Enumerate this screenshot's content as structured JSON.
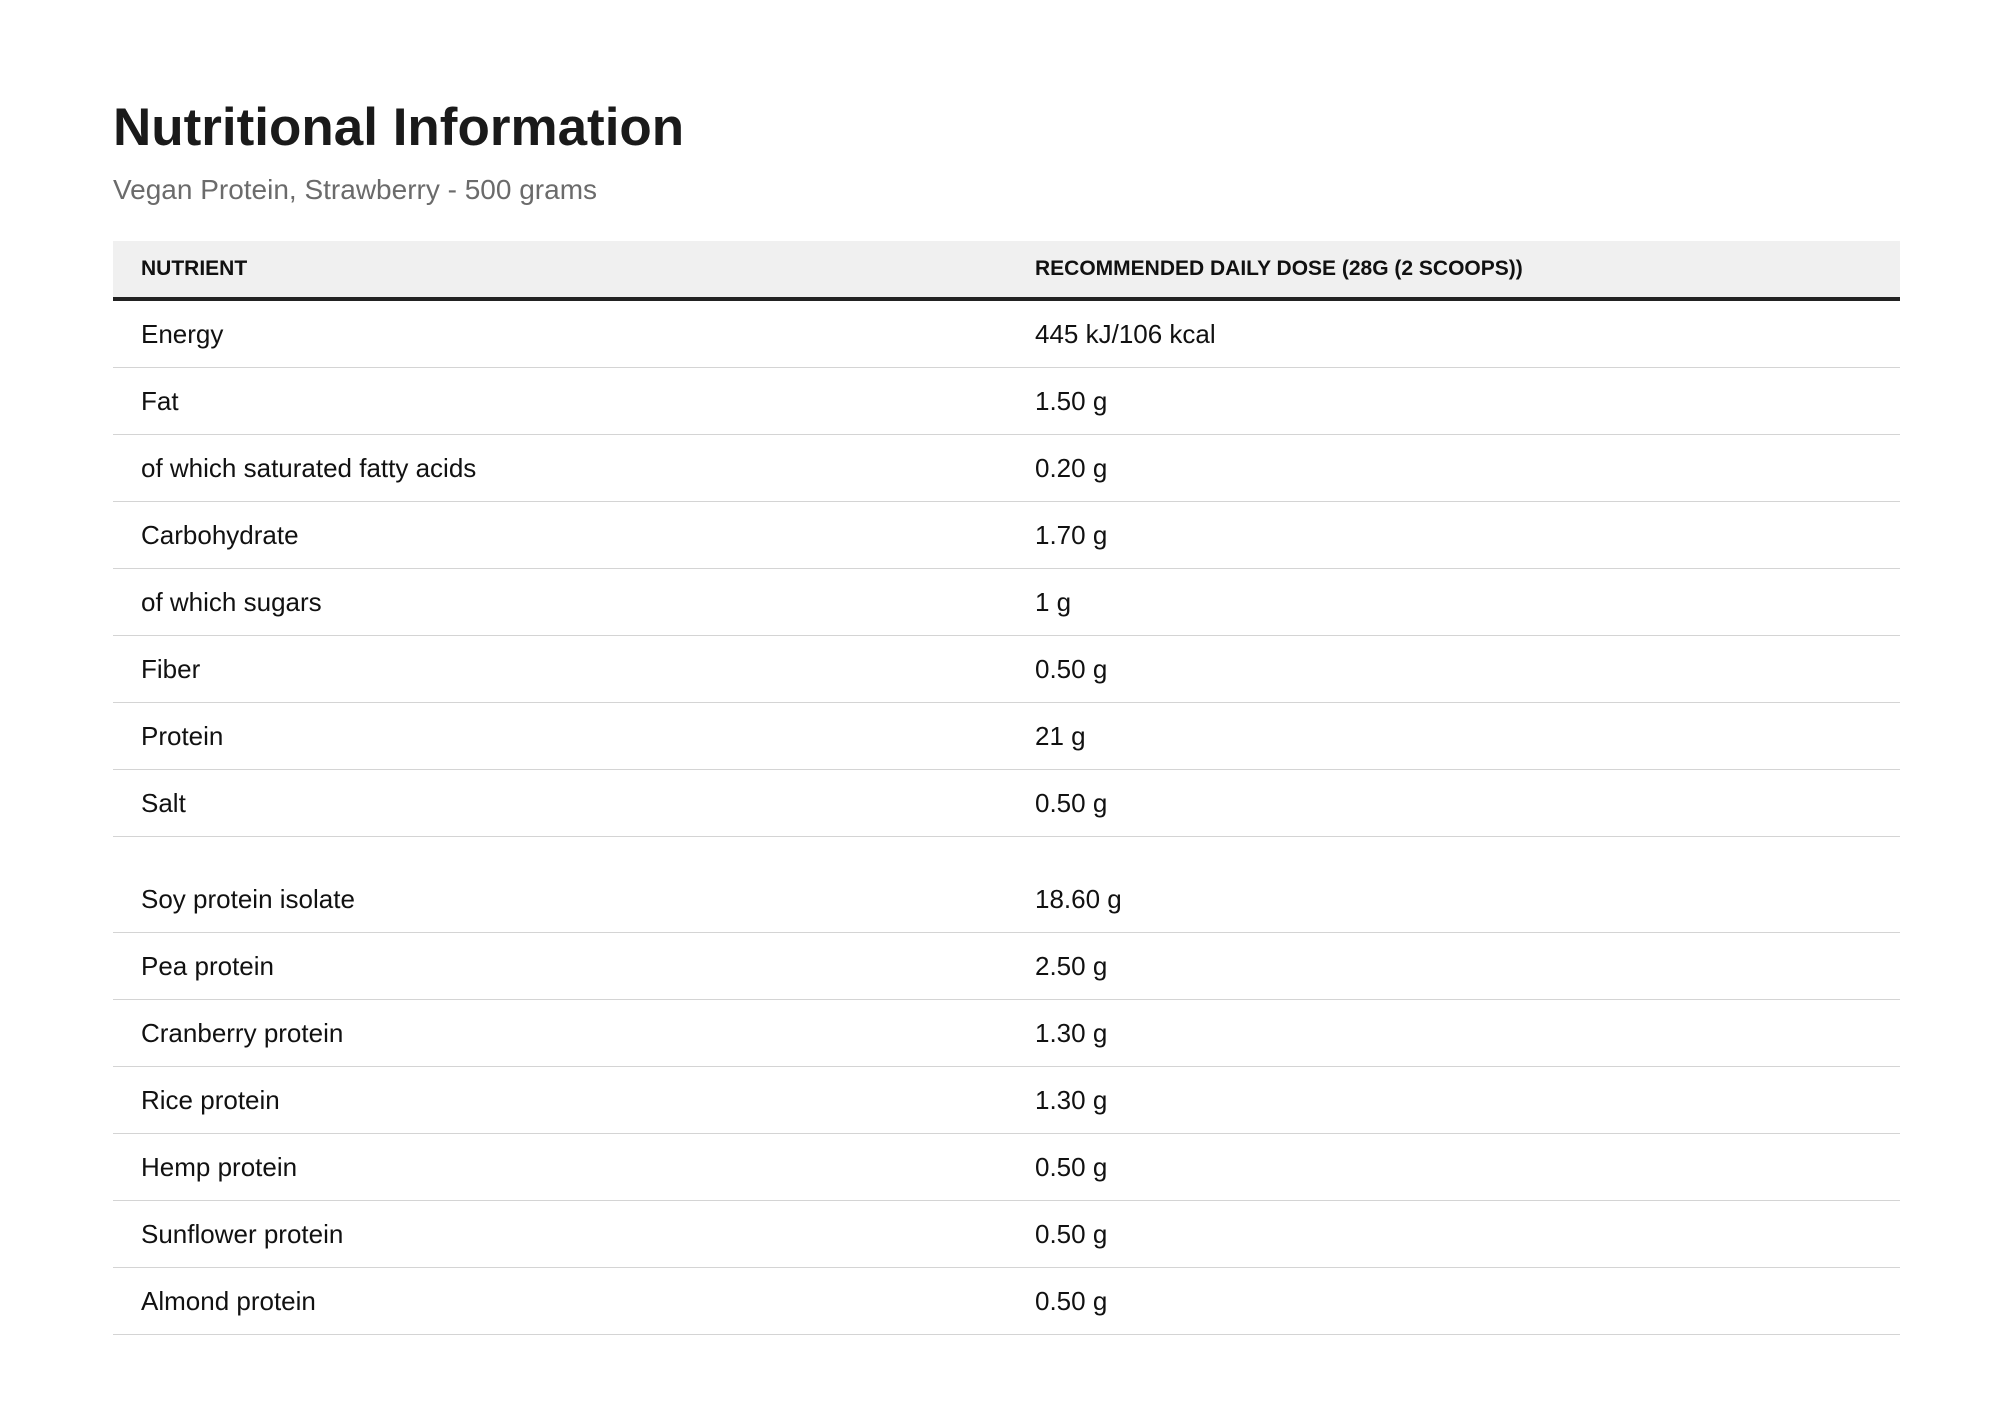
{
  "header": {
    "title": "Nutritional Information",
    "subtitle": "Vegan Protein, Strawberry - 500 grams"
  },
  "table": {
    "columns": [
      "Nutrient",
      "Recommended Daily Dose (28g (2 scoops))"
    ],
    "group1": [
      {
        "nutrient": "Energy",
        "dose": "445 kJ/106 kcal"
      },
      {
        "nutrient": "Fat",
        "dose": "1.50 g"
      },
      {
        "nutrient": "of which saturated fatty acids",
        "dose": "0.20 g"
      },
      {
        "nutrient": "Carbohydrate",
        "dose": "1.70 g"
      },
      {
        "nutrient": "of which sugars",
        "dose": "1 g"
      },
      {
        "nutrient": "Fiber",
        "dose": "0.50 g"
      },
      {
        "nutrient": "Protein",
        "dose": "21 g"
      },
      {
        "nutrient": "Salt",
        "dose": "0.50 g"
      }
    ],
    "group2": [
      {
        "nutrient": "Soy protein isolate",
        "dose": "18.60 g"
      },
      {
        "nutrient": "Pea protein",
        "dose": "2.50 g"
      },
      {
        "nutrient": "Cranberry protein",
        "dose": "1.30 g"
      },
      {
        "nutrient": "Rice protein",
        "dose": "1.30 g"
      },
      {
        "nutrient": "Hemp protein",
        "dose": "0.50 g"
      },
      {
        "nutrient": "Sunflower protein",
        "dose": "0.50 g"
      },
      {
        "nutrient": "Almond protein",
        "dose": "0.50 g"
      }
    ]
  }
}
